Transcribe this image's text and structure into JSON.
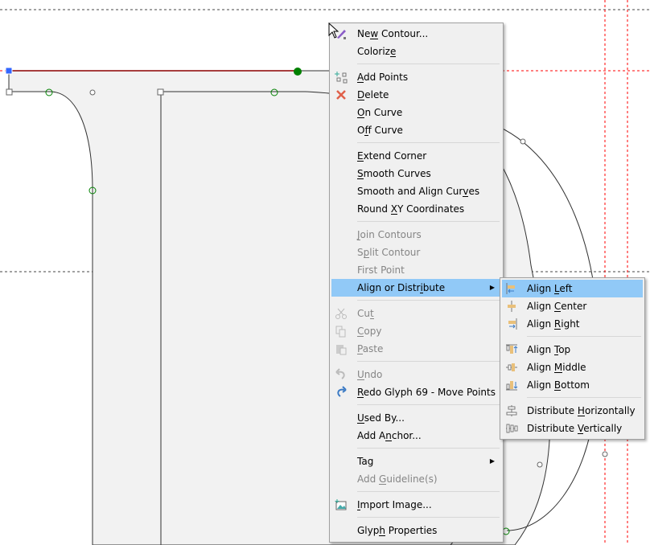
{
  "colors": {
    "menu_bg": "#f0f0f0",
    "highlight": "#91c9f7",
    "disabled": "#8c8c8c",
    "guide_red": "#ff0000",
    "point_green": "#008000",
    "selected_blue": "#3366ff"
  },
  "context_menu": {
    "items": [
      {
        "label": "New Contour...",
        "mn": 2,
        "icon": "pen-contour-icon"
      },
      {
        "label": "Colorize",
        "mn": 7
      },
      {
        "sep": true
      },
      {
        "label": "Add Points",
        "mn": 0,
        "icon": "add-points-icon"
      },
      {
        "label": "Delete",
        "mn": 0,
        "icon": "delete-x-icon"
      },
      {
        "label": "On Curve",
        "mn": 0
      },
      {
        "label": "Off Curve",
        "mn": 1
      },
      {
        "sep": true
      },
      {
        "label": "Extend Corner",
        "mn": 0
      },
      {
        "label": "Smooth Curves",
        "mn": 0
      },
      {
        "label": "Smooth and Align Curves",
        "mn": 20
      },
      {
        "label": "Round XY Coordinates",
        "mn": 6
      },
      {
        "sep": true
      },
      {
        "label": "Join Contours",
        "mn": 0,
        "disabled": true
      },
      {
        "label": "Split Contour",
        "mn": 1,
        "disabled": true
      },
      {
        "label": "First Point",
        "mn": -1,
        "disabled": true
      },
      {
        "label": "Align or Distribute",
        "mn": 14,
        "submenu": true,
        "highlighted": true
      },
      {
        "sep": true
      },
      {
        "label": "Cut",
        "mn": 2,
        "disabled": true,
        "icon": "scissors-icon"
      },
      {
        "label": "Copy",
        "mn": 0,
        "disabled": true,
        "icon": "copy-icon"
      },
      {
        "label": "Paste",
        "mn": 0,
        "disabled": true,
        "icon": "paste-icon"
      },
      {
        "sep": true
      },
      {
        "label": "Undo",
        "mn": 0,
        "disabled": true,
        "icon": "undo-icon"
      },
      {
        "label": "Redo Glyph 69 - Move Points",
        "mn": 0,
        "icon": "redo-icon"
      },
      {
        "sep": true
      },
      {
        "label": "Used By...",
        "mn": 0
      },
      {
        "label": "Add Anchor...",
        "mn": 5
      },
      {
        "sep": true
      },
      {
        "label": "Tag",
        "mn": -1,
        "submenu": true
      },
      {
        "label": "Add Guideline(s)",
        "mn": 4,
        "disabled": true
      },
      {
        "sep": true
      },
      {
        "label": "Import Image...",
        "mn": 0,
        "icon": "image-icon"
      },
      {
        "sep": true
      },
      {
        "label": "Glyph Properties",
        "mn": 4
      }
    ]
  },
  "align_submenu": {
    "items": [
      {
        "label": "Align Left",
        "mn": 6,
        "icon": "align-left-icon",
        "highlighted": true
      },
      {
        "label": "Align Center",
        "mn": 6,
        "icon": "align-center-icon"
      },
      {
        "label": "Align Right",
        "mn": 6,
        "icon": "align-right-icon"
      },
      {
        "sep": true
      },
      {
        "label": "Align Top",
        "mn": 6,
        "icon": "align-top-icon"
      },
      {
        "label": "Align Middle",
        "mn": 6,
        "icon": "align-middle-icon"
      },
      {
        "label": "Align Bottom",
        "mn": 6,
        "icon": "align-bottom-icon"
      },
      {
        "sep": true
      },
      {
        "label": "Distribute Horizontally",
        "mn": 11,
        "icon": "distribute-horizontally-icon"
      },
      {
        "label": "Distribute Vertically",
        "mn": 11,
        "icon": "distribute-vertically-icon"
      }
    ]
  }
}
